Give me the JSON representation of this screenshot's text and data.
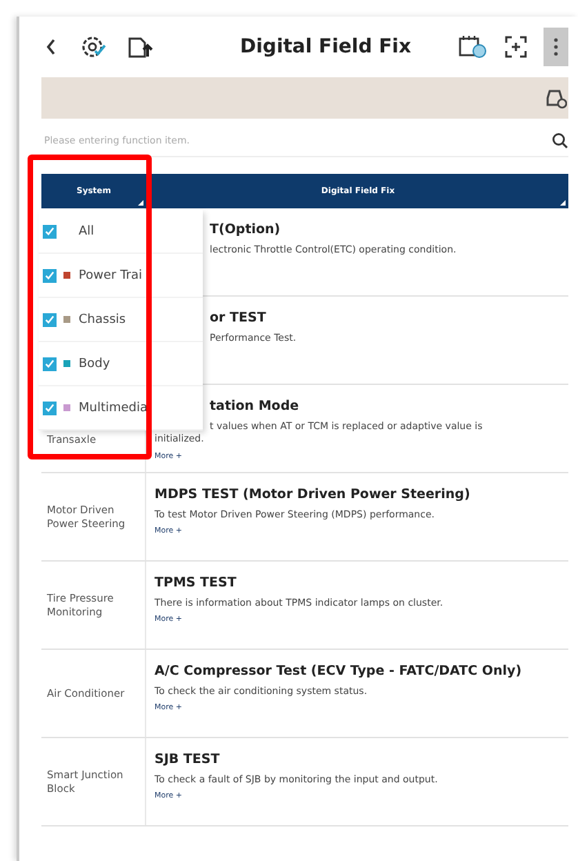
{
  "app_bar": {
    "title": "Digital Field Fix"
  },
  "search": {
    "placeholder": "Please entering function item."
  },
  "table": {
    "columns": [
      "System",
      "Digital Field Fix"
    ],
    "rows": [
      {
        "system": "",
        "covered": true,
        "title": "T(Option)",
        "lines": [
          "lectronic Throttle Control(ETC) operating condition."
        ],
        "more": ""
      },
      {
        "system": "",
        "covered": true,
        "title": "or TEST",
        "lines": [
          "Performance Test."
        ],
        "more": ""
      },
      {
        "system": "Transaxle",
        "covered": true,
        "title": "tation Mode",
        "lines": [
          "t values when AT or TCM is replaced or adaptive value is",
          "initialized."
        ],
        "more": "More +"
      },
      {
        "system": "Motor Driven Power Steering",
        "covered": false,
        "title": "MDPS TEST (Motor Driven Power Steering)",
        "lines": [
          "To test Motor Driven Power Steering (MDPS) performance."
        ],
        "more": "More +"
      },
      {
        "system": "Tire Pressure Monitoring",
        "covered": false,
        "title": "TPMS TEST",
        "lines": [
          "There is information about TPMS indicator lamps on cluster."
        ],
        "more": "More +"
      },
      {
        "system": "Air Conditioner",
        "covered": false,
        "title": "A/C Compressor Test (ECV Type - FATC/DATC Only)",
        "lines": [
          "To check the air conditioning system status."
        ],
        "more": "More +"
      },
      {
        "system": "Smart Junction Block",
        "covered": false,
        "title": "SJB TEST",
        "lines": [
          "To check a fault of SJB by monitoring the input and output."
        ],
        "more": "More +"
      }
    ]
  },
  "system_filter": {
    "items": [
      {
        "label": "All",
        "checked": true
      },
      {
        "label": "Power Trai",
        "checked": true,
        "color": "#c0452f"
      },
      {
        "label": "Chassis",
        "checked": true,
        "color": "#a89a86"
      },
      {
        "label": "Body",
        "checked": true,
        "color": "#1aa3b8"
      },
      {
        "label": "Multimedia",
        "checked": true,
        "color": "#c99ad0"
      }
    ]
  }
}
